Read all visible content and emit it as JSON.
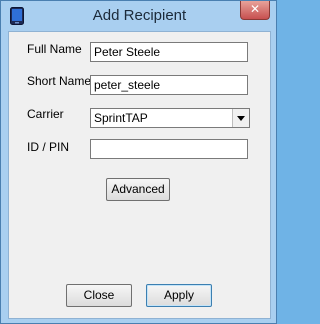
{
  "window": {
    "title": "Add Recipient",
    "close_label": "✕",
    "app_icon": "phone-icon"
  },
  "form": {
    "full_name_label": "Full Name",
    "full_name_value": "Peter Steele",
    "short_name_label": "Short Name",
    "short_name_value": "peter_steele",
    "carrier_label": "Carrier",
    "carrier_value": "SprintTAP",
    "id_pin_label": "ID / PIN",
    "id_pin_value": ""
  },
  "buttons": {
    "advanced": "Advanced",
    "close": "Close",
    "apply": "Apply"
  },
  "colors": {
    "title_bar": "#a9cff0",
    "client_bg": "#f0f0f0",
    "close_button": "#c75050"
  }
}
